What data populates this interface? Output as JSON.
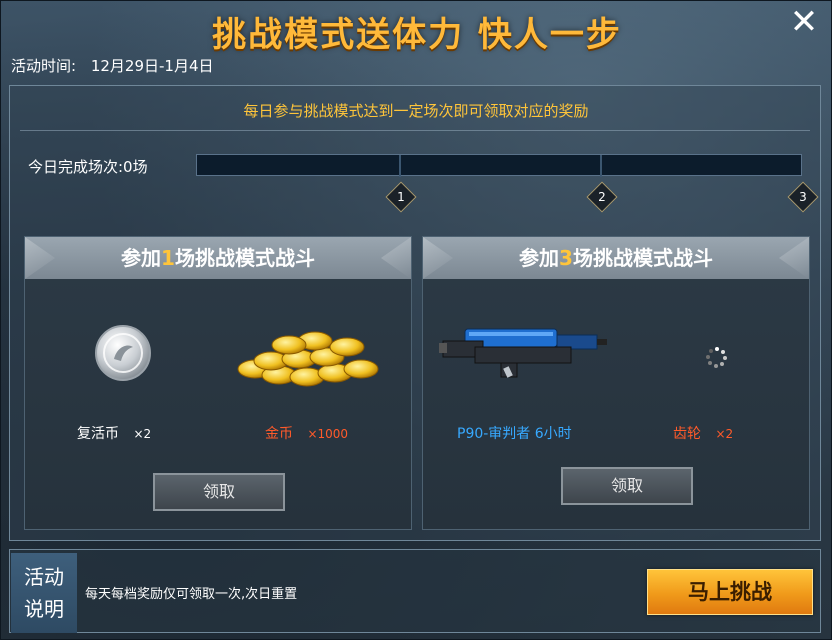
{
  "header": {
    "title": "挑战模式送体力 快人一步",
    "close_icon": "close-icon"
  },
  "event_time": {
    "label": "活动时间:",
    "value": "12月29日-1月4日"
  },
  "task": {
    "description": "每日参与挑战模式达到一定场次即可领取对应的奖励",
    "progress_label": "今日完成场次:0场",
    "completed": 0,
    "total": 3,
    "markers": [
      "1",
      "2",
      "3"
    ]
  },
  "cards": [
    {
      "title_prefix": "参加",
      "title_count": "1",
      "title_suffix": "场挑战模式战斗",
      "rewards": [
        {
          "name": "复活币",
          "qty": "×2",
          "icon": "revive-coin-icon",
          "color": "#ffffff"
        },
        {
          "name": "金币",
          "qty": "×1000",
          "icon": "gold-coins-icon",
          "color": "#ff5a2a"
        }
      ],
      "button_label": "领取"
    },
    {
      "title_prefix": "参加",
      "title_count": "3",
      "title_suffix": "场挑战模式战斗",
      "rewards": [
        {
          "name": "P90-审判者 6小时",
          "qty": "",
          "icon": "p90-weapon-icon",
          "color": "#37a9ff"
        },
        {
          "name": "齿轮",
          "qty": "×2",
          "icon": "gear-icon",
          "color": "#ff5a2a"
        }
      ],
      "button_label": "领取"
    }
  ],
  "footer": {
    "tag_line1": "活动",
    "tag_line2": "说明",
    "rules": "每天每档奖励仅可领取一次,次日重置",
    "challenge_button": "马上挑战"
  },
  "colors": {
    "title": "#ffb93a",
    "highlight": "#ffc53a",
    "button_primary": "#f09a1a"
  }
}
